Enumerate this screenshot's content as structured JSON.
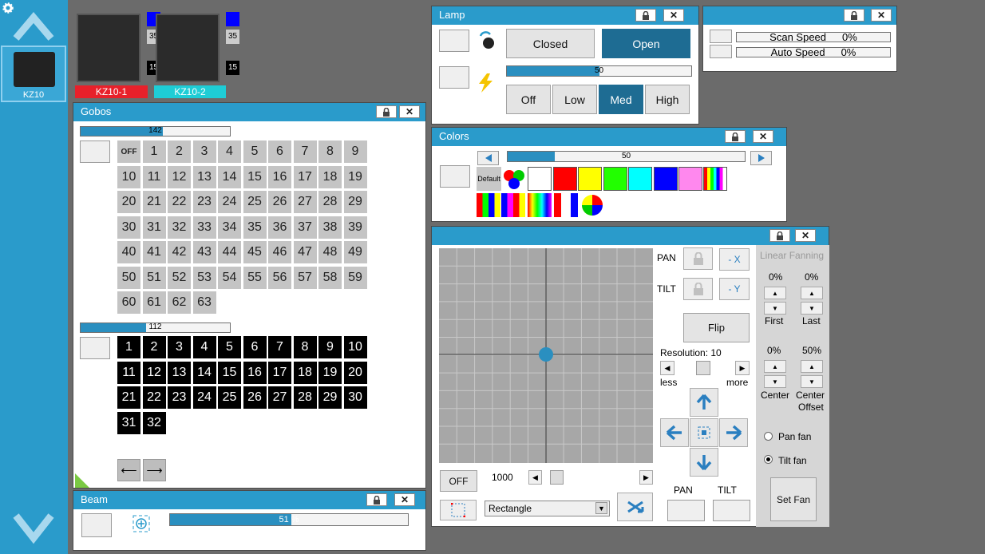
{
  "sidebar": {
    "fixture_label": "KZ10"
  },
  "fixtures": [
    {
      "label": "KZ10-1",
      "top_num": "35",
      "bottom_num": "15",
      "label_color": "#e8202a"
    },
    {
      "label": "KZ10-2",
      "top_num": "35",
      "bottom_num": "15",
      "label_color": "#1ecdd6"
    }
  ],
  "gobos": {
    "title": "Gobos",
    "slider1_value": "142",
    "slider1_fraction": 0.55,
    "slider2_value": "112",
    "slider2_fraction": 0.44,
    "grid1": [
      "OFF",
      "1",
      "2",
      "3",
      "4",
      "5",
      "6",
      "7",
      "8",
      "9",
      "10",
      "11",
      "12",
      "13",
      "14",
      "15",
      "16",
      "17",
      "18",
      "19",
      "20",
      "21",
      "22",
      "23",
      "24",
      "25",
      "26",
      "27",
      "28",
      "29",
      "30",
      "31",
      "32",
      "33",
      "34",
      "35",
      "36",
      "37",
      "38",
      "39",
      "40",
      "41",
      "42",
      "43",
      "44",
      "45",
      "46",
      "47",
      "48",
      "49",
      "50",
      "51",
      "52",
      "53",
      "54",
      "55",
      "56",
      "57",
      "58",
      "59",
      "60",
      "61",
      "62",
      "63"
    ],
    "grid2": [
      "1",
      "2",
      "3",
      "4",
      "5",
      "6",
      "7",
      "8",
      "9",
      "10",
      "11",
      "12",
      "13",
      "14",
      "15",
      "16",
      "17",
      "18",
      "19",
      "20",
      "21",
      "22",
      "23",
      "24",
      "25",
      "26",
      "27",
      "28",
      "29",
      "30",
      "31",
      "32"
    ]
  },
  "beam": {
    "title": "Beam",
    "value": "51 %",
    "fraction": 0.51
  },
  "lamp": {
    "title": "Lamp",
    "closed": "Closed",
    "open": "Open",
    "slider_value": "50",
    "slider_fraction": 0.5,
    "off": "Off",
    "low": "Low",
    "med": "Med",
    "high": "High"
  },
  "speed": {
    "scan_label": "Scan Speed",
    "scan_value": "0%",
    "auto_label": "Auto Speed",
    "auto_value": "0%"
  },
  "colors": {
    "title": "Colors",
    "slider_value": "50",
    "slider_fraction": 0.2,
    "default_label": "Default",
    "swatches": [
      "#ffffff",
      "#ff0000",
      "#ffff00",
      "#22ff00",
      "#00ffff",
      "#0000ff",
      "#ff88ee"
    ]
  },
  "position": {
    "pan": "PAN",
    "tilt": "TILT",
    "neg_x": "- X",
    "neg_y": "- Y",
    "flip": "Flip",
    "resolution": "Resolution: 10",
    "less": "less",
    "more": "more",
    "off": "OFF",
    "size_value": "1000",
    "shape": "Rectangle",
    "pan_bottom": "PAN",
    "tilt_bottom": "TILT"
  },
  "fanning": {
    "title": "Linear Fanning",
    "first_val": "0%",
    "last_val": "0%",
    "first": "First",
    "last": "Last",
    "center_val": "0%",
    "offset_val": "50%",
    "center": "Center",
    "center_offset_l1": "Center",
    "center_offset_l2": "Offset",
    "pan_fan": "Pan fan",
    "tilt_fan": "Tilt fan",
    "set_fan": "Set Fan"
  }
}
